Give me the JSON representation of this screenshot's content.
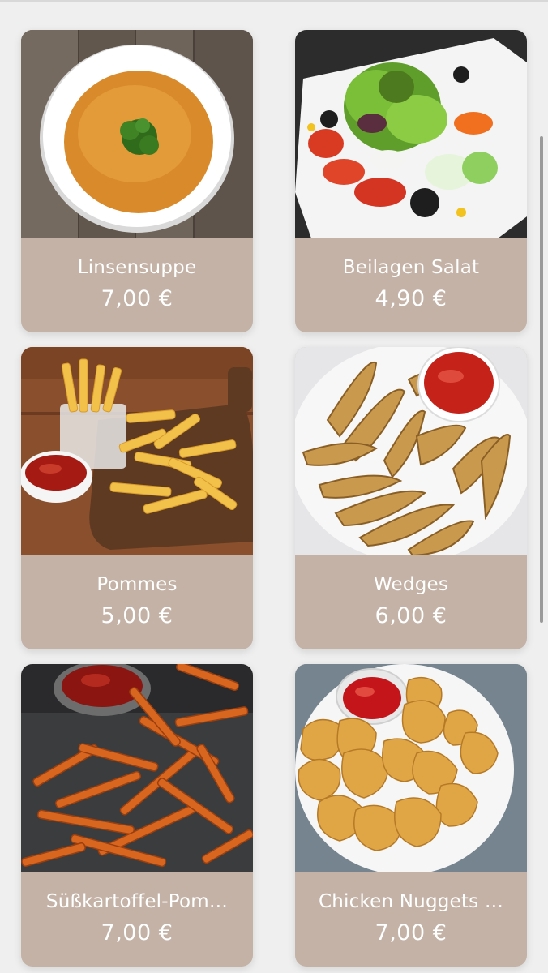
{
  "menu": {
    "items": [
      {
        "name": "Linsensuppe",
        "price": "7,00 €",
        "image": "lentil-soup"
      },
      {
        "name": "Beilagen Salat",
        "price": "4,90 €",
        "image": "side-salad"
      },
      {
        "name": "Pommes",
        "price": "5,00 €",
        "image": "french-fries"
      },
      {
        "name": "Wedges",
        "price": "6,00 €",
        "image": "potato-wedges"
      },
      {
        "name": "Süßkartoffel-Pom…",
        "price": "7,00 €",
        "image": "sweet-potato-fries"
      },
      {
        "name": "Chicken Nuggets …",
        "price": "7,00 €",
        "image": "chicken-nuggets"
      }
    ]
  },
  "colors": {
    "background": "#efefef",
    "card_footer": "#c3b2a5",
    "text": "#ffffff"
  }
}
